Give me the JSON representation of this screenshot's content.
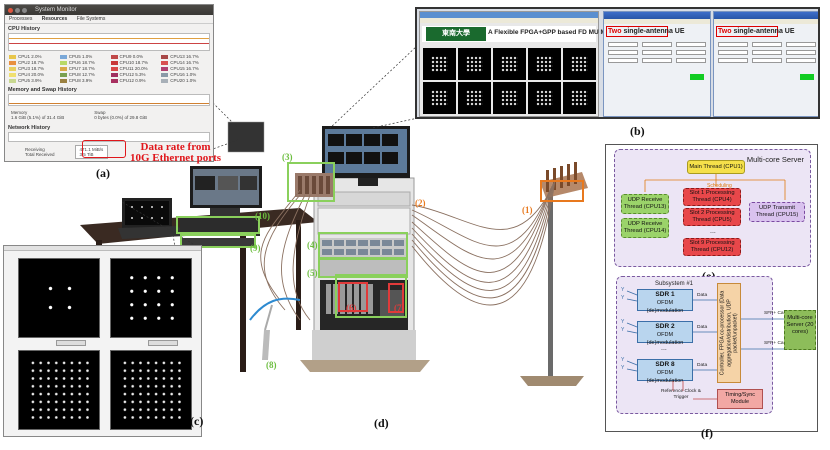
{
  "captions": {
    "a": "(a)",
    "b": "(b)",
    "c": "(c)",
    "d": "(d)",
    "e": "(e)",
    "f": "(f)"
  },
  "callout": {
    "line1": "Data rate from",
    "line2": "10G Ethernet ports"
  },
  "sysmon": {
    "title": "System Monitor",
    "tabs": [
      "Processes",
      "Resources",
      "File Systems"
    ],
    "cpu_section": "CPU History",
    "mem_section": "Memory and Swap History",
    "net_section": "Network History",
    "cpus": [
      {
        "label": "CPU1 2.0%",
        "color": "#e8c64a"
      },
      {
        "label": "CPU5 1.0%",
        "color": "#7aa8d8"
      },
      {
        "label": "CPU9 0.0%",
        "color": "#c04848"
      },
      {
        "label": "CPU13 16.7%",
        "color": "#a84848"
      },
      {
        "label": "CPU2 18.7%",
        "color": "#e89040"
      },
      {
        "label": "CPU6 18.7%",
        "color": "#b8d868"
      },
      {
        "label": "CPU10 18.7%",
        "color": "#c83838"
      },
      {
        "label": "CPU14 16.7%",
        "color": "#d85050"
      },
      {
        "label": "CPU3 18.7%",
        "color": "#e8d060"
      },
      {
        "label": "CPU7 18.7%",
        "color": "#d8a848"
      },
      {
        "label": "CPU11 20.0%",
        "color": "#d84848"
      },
      {
        "label": "CPU15 16.7%",
        "color": "#b04070"
      },
      {
        "label": "CPU4 20.0%",
        "color": "#f0e070"
      },
      {
        "label": "CPU8 12.7%",
        "color": "#7aa050"
      },
      {
        "label": "CPU12 5.3%",
        "color": "#a03060"
      },
      {
        "label": "CPU16 1.0%",
        "color": "#8a9aa8"
      },
      {
        "label": "CPU5 3.9%",
        "color": "#c8d890"
      },
      {
        "label": "CPU8 3.9%",
        "color": "#9a8040"
      },
      {
        "label": "CPU12 0.9%",
        "color": "#a83060"
      },
      {
        "label": "CPU20 1.0%",
        "color": "#a8b0b8"
      }
    ],
    "memory": "Memory",
    "memory_value": "1.6 GiB (5.1%) of 31.4 GiB",
    "swap": "Swap",
    "swap_value": "0 bytes (0.0%) of 29.8 GiB",
    "receiving": "Receiving",
    "total_received": "Total Received",
    "rate_rx": "471.1 MiB/s",
    "rate_total": "3.5 TiB"
  },
  "labview": {
    "banner": "A Flexible FPGA+GPP based FD MU MI",
    "logo": "東南大學",
    "ue_prefix": "Two",
    "ue_suffix": "single-antenna UE"
  },
  "markers": {
    "n1": "(1)",
    "n2": "(2)",
    "n3": "(3)",
    "n4": "(4)",
    "n5": "(5)",
    "n6": "(6)",
    "n7": "(7)",
    "n8": "(8)",
    "n9": "(9)",
    "n10": "(10)"
  },
  "server_diagram": {
    "title": "Multi-core Server",
    "main_thread": "Main Thread (CPU1)",
    "scheduling": "Scheduling",
    "udp_rx1": "UDP Receive Thread (CPU13)",
    "udp_rx2": "UDP Receive Thread (CPU14)",
    "slot1": "Slot 1 Processing Thread (CPU4)",
    "slot2": "Slot 2 Processing Thread (CPU5)",
    "slot_ellipsis": "...",
    "slot9": "Slot 9 Processing Thread (CPU12)",
    "udp_tx": "UDP Transmit Thread (CPU15)"
  },
  "subsystem_diagram": {
    "title": "Subsystem #1",
    "sdr_units": [
      {
        "name": "SDR 1",
        "desc": "OFDM (de)modulation"
      },
      {
        "name": "SDR 2",
        "desc": "OFDM (de)modulation"
      },
      {
        "name": "SDR 8",
        "desc": "OFDM (de)modulation"
      }
    ],
    "data": "Data",
    "ellipsis": "...",
    "controller": "Controller, FPGA co-processor (Data aggregation/distribution, UDP packet/unpacket)",
    "timing": "Timing/Sync Module",
    "ref_clock": "Reference Clock & Trigger",
    "sfp1": "SFP+ Cable",
    "sfp2": "SFP+ Cable",
    "server": "Multi-core Server (20 cores)"
  }
}
